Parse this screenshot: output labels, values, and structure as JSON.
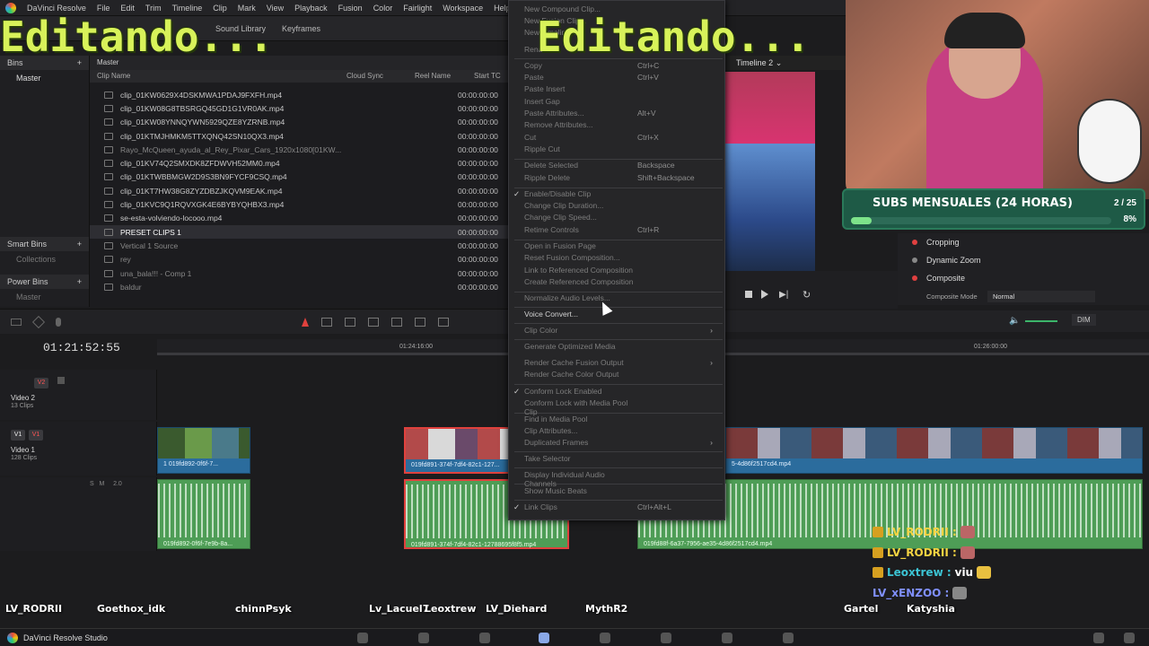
{
  "overlay": {
    "title_left": "Editando...",
    "title_right": "Editando..."
  },
  "menubar": {
    "items": [
      "DaVinci Resolve",
      "File",
      "Edit",
      "Trim",
      "Timeline",
      "Clip",
      "Mark",
      "View",
      "Playback",
      "Fusion",
      "Color",
      "Fairlight",
      "Workspace",
      "Help"
    ]
  },
  "toolbar": {
    "sound_library": "Sound Library",
    "keyframes": "Keyframes"
  },
  "bins": {
    "header": "Bins",
    "master": "Master",
    "smart_bins": "Smart Bins",
    "collections": "Collections",
    "power_bins": "Power Bins",
    "power_master": "Master"
  },
  "clip_list": {
    "path": "Master",
    "columns": [
      "Clip Name",
      "Cloud Sync",
      "Reel Name",
      "Start TC"
    ],
    "rows": [
      {
        "name": "clip_01KW0629X4DSKMWA1PDAJ9FXFH.mp4",
        "tc": "00:00:00:00"
      },
      {
        "name": "clip_01KW08G8TBSRGQ45GD1G1VR0AK.mp4",
        "tc": "00:00:00:00"
      },
      {
        "name": "clip_01KW08YNNQYWN5929QZE8YZRNB.mp4",
        "tc": "00:00:00:00"
      },
      {
        "name": "clip_01KTMJHMKM5TTXQNQ42SN10QX3.mp4",
        "tc": "00:00:00:00"
      },
      {
        "name": "Rayo_McQueen_ayuda_al_Rey_Pixar_Cars_1920x1080[01KW...",
        "tc": "00:00:00:00"
      },
      {
        "name": "clip_01KV74Q2SMXDK8ZFDWVH52MM0.mp4",
        "tc": "00:00:00:00"
      },
      {
        "name": "clip_01KTWBBMGW2D9S3BN9FYCF9CSQ.mp4",
        "tc": "00:00:00:00"
      },
      {
        "name": "clip_01KT7HW38G8ZYZDBZJKQVM9EAK.mp4",
        "tc": "00:00:00:00"
      },
      {
        "name": "clip_01KVC9Q1RQVXGK4E6BYBYQHBX3.mp4",
        "tc": "00:00:00:00"
      },
      {
        "name": "se-esta-volviendo-locooo.mp4",
        "tc": "00:00:00:00"
      },
      {
        "name": "PRESET CLIPS 1",
        "tc": "00:00:00:00"
      },
      {
        "name": "Vertical 1 Source",
        "tc": "00:00:00:00"
      },
      {
        "name": "rey",
        "tc": "00:00:00:00"
      },
      {
        "name": "una_bala!!! - Comp 1",
        "tc": "00:00:00:00"
      },
      {
        "name": "baldur",
        "tc": "00:00:00:00"
      }
    ]
  },
  "timeline": {
    "timecode": "01:21:52:55",
    "ruler_labels": [
      "01:24:16:00",
      "01:26:00:00"
    ],
    "tracks": {
      "v2": {
        "badge": "V2",
        "name": "Video 2",
        "count": "13 Clips"
      },
      "v1": {
        "badge": "V1",
        "badge2": "V1",
        "name": "Video 1",
        "count": "128 Clips"
      },
      "a1": {
        "level": "2.0",
        "s": "S",
        "m": "M"
      }
    },
    "video_clips": [
      "1 019fd892-0f6f-7...",
      "019fd891-374f-7df4-82c1-127...",
      "5-4d86f2517cd4.mp4"
    ],
    "audio_clips": [
      "019fd892-0f6f-7e9b-8a...",
      "019fd891-374f-7df4-82c1-12788695f8f5.mp4",
      "019fd88f-6a37-7956-ae35-4d86f2517cd4.mp4"
    ]
  },
  "context_menu": {
    "items": [
      {
        "label": "New Compound Clip...",
        "shortcut": "",
        "disabled": true
      },
      {
        "label": "New Fusion Clip...",
        "shortcut": "",
        "disabled": true
      },
      {
        "label": "New Timeline...",
        "shortcut": "",
        "disabled": true
      },
      {
        "label": "Rename...",
        "shortcut": "",
        "disabled": true
      },
      {
        "label": "Copy",
        "shortcut": "Ctrl+C",
        "disabled": true
      },
      {
        "label": "Paste",
        "shortcut": "Ctrl+V",
        "disabled": true
      },
      {
        "label": "Paste Insert",
        "shortcut": "",
        "disabled": true
      },
      {
        "label": "Insert Gap",
        "shortcut": "",
        "disabled": true
      },
      {
        "label": "Paste Attributes...",
        "shortcut": "Alt+V",
        "disabled": true
      },
      {
        "label": "Remove Attributes...",
        "shortcut": "",
        "disabled": true
      },
      {
        "label": "Cut",
        "shortcut": "Ctrl+X",
        "disabled": true
      },
      {
        "label": "Ripple Cut",
        "shortcut": "",
        "disabled": true
      },
      {
        "label": "Delete Selected",
        "shortcut": "Backspace",
        "disabled": true
      },
      {
        "label": "Ripple Delete",
        "shortcut": "Shift+Backspace",
        "disabled": true
      },
      {
        "label": "Enable/Disable Clip",
        "shortcut": "",
        "disabled": true,
        "checked": true
      },
      {
        "label": "Change Clip Duration...",
        "shortcut": "",
        "disabled": true
      },
      {
        "label": "Change Clip Speed...",
        "shortcut": "",
        "disabled": true
      },
      {
        "label": "Retime Controls",
        "shortcut": "Ctrl+R",
        "disabled": true
      },
      {
        "label": "Open in Fusion Page",
        "shortcut": "",
        "disabled": true
      },
      {
        "label": "Reset Fusion Composition...",
        "shortcut": "",
        "disabled": true
      },
      {
        "label": "Link to Referenced Composition",
        "shortcut": "",
        "disabled": true
      },
      {
        "label": "Create Referenced Composition",
        "shortcut": "",
        "disabled": true
      },
      {
        "label": "Normalize Audio Levels...",
        "shortcut": "",
        "disabled": true
      },
      {
        "label": "Voice Convert...",
        "shortcut": "",
        "disabled": false
      },
      {
        "label": "Clip Color",
        "shortcut": "",
        "disabled": true,
        "submenu": true
      },
      {
        "label": "Generate Optimized Media",
        "shortcut": "",
        "disabled": true
      },
      {
        "label": "Render Cache Fusion Output",
        "shortcut": "",
        "disabled": true,
        "submenu": true
      },
      {
        "label": "Render Cache Color Output",
        "shortcut": "",
        "disabled": true
      },
      {
        "label": "Conform Lock Enabled",
        "shortcut": "",
        "disabled": true,
        "checked": true
      },
      {
        "label": "Conform Lock with Media Pool Clip",
        "shortcut": "",
        "disabled": true
      },
      {
        "label": "Find in Media Pool",
        "shortcut": "",
        "disabled": true
      },
      {
        "label": "Clip Attributes...",
        "shortcut": "",
        "disabled": true
      },
      {
        "label": "Duplicated Frames",
        "shortcut": "",
        "disabled": true,
        "submenu": true
      },
      {
        "label": "Take Selector",
        "shortcut": "",
        "disabled": true
      },
      {
        "label": "Display Individual Audio Channels",
        "shortcut": "",
        "disabled": true
      },
      {
        "label": "Show Music Beats",
        "shortcut": "",
        "disabled": true
      },
      {
        "label": "Link Clips",
        "shortcut": "Ctrl+Alt+L",
        "disabled": true,
        "checked": true
      }
    ]
  },
  "viewer": {
    "timeline_name": "Timeline 2"
  },
  "subs": {
    "label": "SUBS MENSUALES (24 HORAS)",
    "count": "2 / 25",
    "percent_text": "8%",
    "percent": 0.08
  },
  "inspector": {
    "cropping": "Cropping",
    "dynamic_zoom": "Dynamic Zoom",
    "composite": "Composite",
    "composite_mode_label": "Composite Mode",
    "composite_mode_value": "Normal"
  },
  "audio_meter": {
    "dim": "DIM"
  },
  "chat": [
    {
      "user": "LV_RODRII :",
      "msg": ""
    },
    {
      "user": "LV_RODRII :",
      "msg": ""
    },
    {
      "user": "Leoxtrew :",
      "msg": "viu"
    },
    {
      "user": "LV_xENZOO :",
      "msg": ""
    }
  ],
  "viewer_names": [
    "LV_RODRII",
    "Goethox_idk",
    "chinnPsyk",
    "Lv_Lacuel7",
    "Leoxtrew",
    "LV_Diehard",
    "MythR2",
    "Gartel",
    "Katyshia"
  ],
  "taskbar": {
    "app": "DaVinci Resolve Studio"
  }
}
